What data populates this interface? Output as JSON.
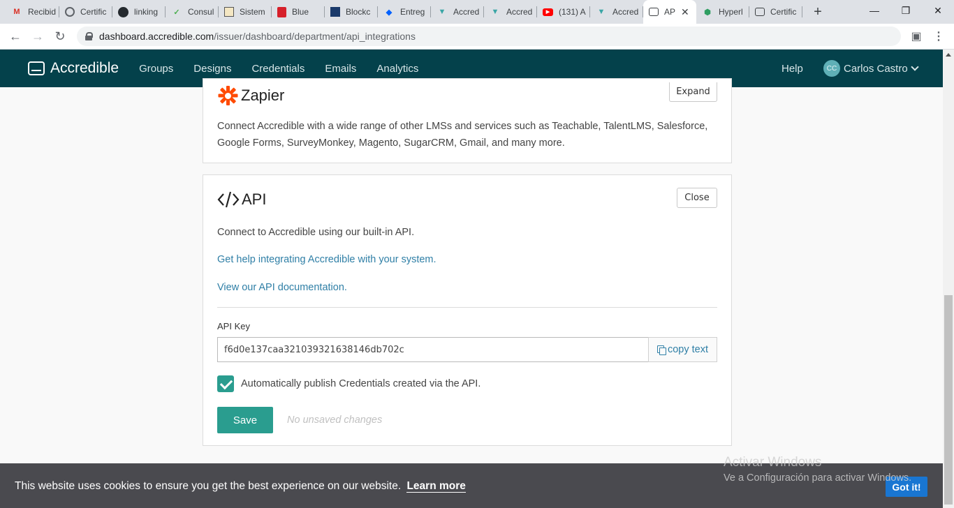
{
  "browser": {
    "tabs": [
      {
        "title": "Recibid",
        "icon": "gmail-icon"
      },
      {
        "title": "Certific",
        "icon": "globe-icon"
      },
      {
        "title": "linking",
        "icon": "github-icon"
      },
      {
        "title": "Consul",
        "icon": "check-icon"
      },
      {
        "title": "Sistem",
        "icon": "image-icon"
      },
      {
        "title": "Blue",
        "icon": "blue-shield-icon"
      },
      {
        "title": "Blockc",
        "icon": "block-icon"
      },
      {
        "title": "Entreg",
        "icon": "dropbox-icon"
      },
      {
        "title": "Accred",
        "icon": "accredible-icon"
      },
      {
        "title": "Accred",
        "icon": "accredible-icon"
      },
      {
        "title": "(131) A",
        "icon": "youtube-icon"
      },
      {
        "title": "Accred",
        "icon": "accredible-icon"
      },
      {
        "title": "AP",
        "icon": "accredible-card-icon",
        "active": true
      },
      {
        "title": "Hyperl",
        "icon": "hyperledger-icon"
      },
      {
        "title": "Certific",
        "icon": "accredible-card-icon"
      }
    ],
    "url_host": "dashboard.accredible.com",
    "url_path": "/issuer/dashboard/department/api_integrations"
  },
  "nav": {
    "logo": "Accredible",
    "links": [
      "Groups",
      "Designs",
      "Credentials",
      "Emails",
      "Analytics"
    ],
    "help": "Help",
    "user_initials": "CC",
    "user_name": "Carlos Castro"
  },
  "zapier": {
    "title": "Zapier",
    "expand_label": "Expand",
    "description_line1": "Connect Accredible with a wide range of other LMSs and services such as Teachable, TalentLMS, Salesforce,",
    "description_line2": "Google Forms, SurveyMonkey, Magento, SugarCRM, Gmail, and many more."
  },
  "api": {
    "title": "API",
    "close_label": "Close",
    "description": "Connect to Accredible using our built-in API.",
    "help_link": "Get help integrating Accredible with your system.",
    "docs_link": "View our API documentation.",
    "key_label": "API Key",
    "key_value": "f6d0e137caa321039321638146db702c",
    "copy_label": "copy text",
    "auto_publish_label": "Automatically publish Credentials created via the API.",
    "auto_publish_checked": true,
    "save_label": "Save",
    "status": "No unsaved changes"
  },
  "cookie": {
    "text": "This website uses cookies to ensure you get the best experience on our website.",
    "learn_more": "Learn more",
    "got_it": "Got it!"
  },
  "watermark": {
    "line1": "Activar Windows",
    "line2": "Ve a Configuración para activar Windows."
  },
  "colors": {
    "nav_bg": "#04414b",
    "accent": "#2a9d8f",
    "link": "#2f7fa6",
    "cookie_bg": "#4a4a4f",
    "got_it_bg": "#1976d2"
  }
}
